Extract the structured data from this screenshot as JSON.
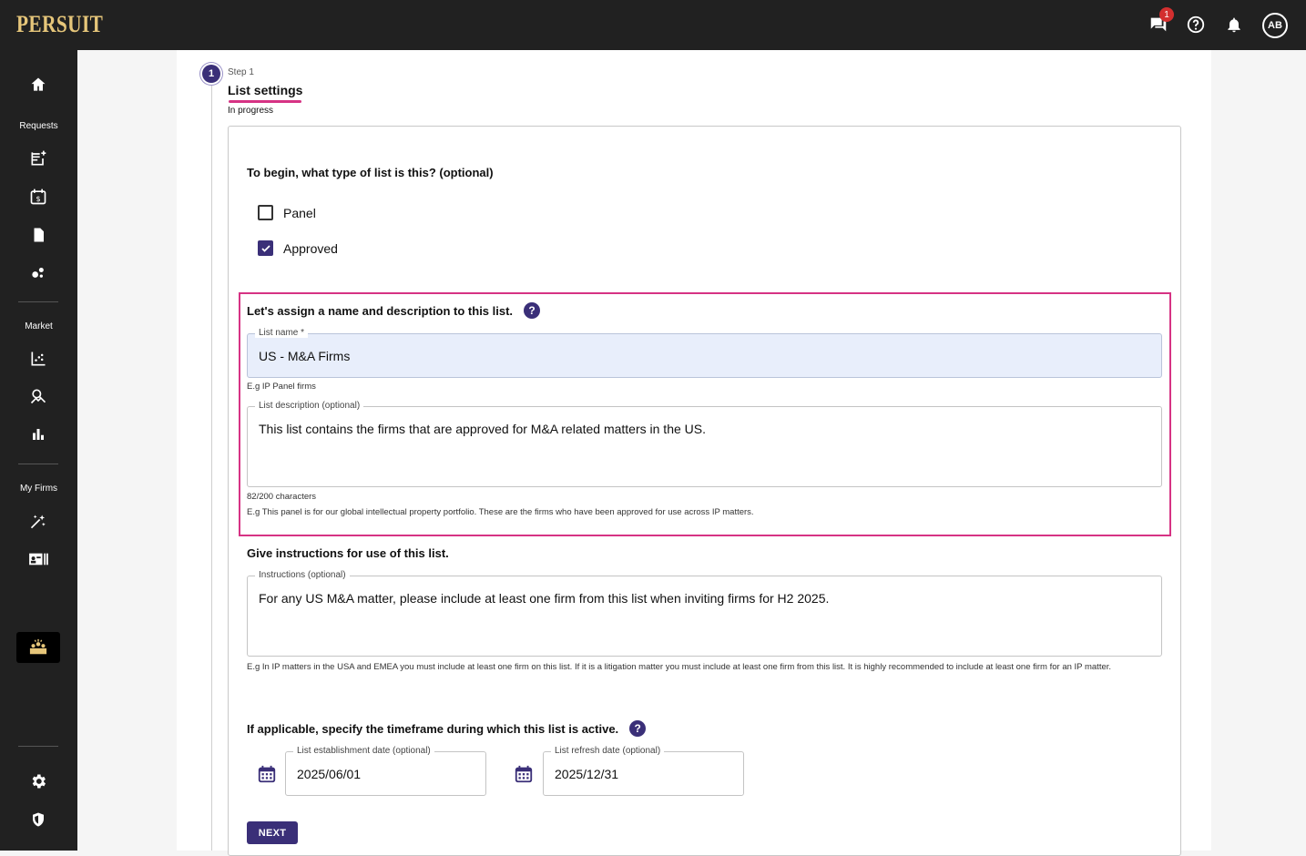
{
  "app": {
    "logo": "PERSUIT"
  },
  "topbar": {
    "icons": [
      "chat-icon",
      "help-icon",
      "bell-icon"
    ],
    "chat_badge": "1",
    "avatar": "AB"
  },
  "sidebar": {
    "sections": {
      "requests": "Requests",
      "market": "Market",
      "my_firms": "My Firms"
    },
    "icons": [
      "home-icon",
      "new-request-icon",
      "calendar-dollar-icon",
      "document-icon",
      "bubbles-icon",
      "scatter-chart-icon",
      "analytics-icon",
      "bar-chart-icon",
      "sparkle-icon",
      "firm-card-icon",
      "panel-list-icon",
      "settings-icon",
      "shield-icon"
    ]
  },
  "step": {
    "number": "1",
    "label": "Step 1",
    "title": "List settings",
    "status": "In progress"
  },
  "list_type": {
    "question": "To begin, what type of list is this? (optional)",
    "options": [
      {
        "label": "Panel",
        "checked": false
      },
      {
        "label": "Approved",
        "checked": true
      }
    ]
  },
  "name_section": {
    "heading": "Let's assign a name and description to this list.",
    "help": "?",
    "list_name": {
      "label": "List name *",
      "value": "US - M&A Firms",
      "hint": "E.g IP Panel firms"
    },
    "description": {
      "label": "List description (optional)",
      "value": "This list contains the firms that are approved for M&A related matters in the US.",
      "count": "82/200 characters",
      "hint": "E.g This panel is for our global intellectual property portfolio. These are the firms who have been approved for use across IP matters."
    }
  },
  "instructions": {
    "heading": "Give instructions for use of this list.",
    "label": "Instructions (optional)",
    "value": "For any US M&A matter, please include at least one firm from this list when inviting firms for H2 2025.",
    "hint": "E.g In IP matters in the USA and EMEA you must include at least one firm on this list. If it is a litigation matter you must include at least one firm from this list. It is highly recommended to include at least one firm for an IP matter."
  },
  "timeframe": {
    "heading": "If applicable, specify the timeframe during which this list is active.",
    "help": "?",
    "establishment": {
      "label": "List establishment date (optional)",
      "value": "2025/06/01"
    },
    "refresh": {
      "label": "List refresh date (optional)",
      "value": "2025/12/31"
    }
  },
  "actions": {
    "next": "NEXT"
  },
  "colors": {
    "accent": "#3a2f78",
    "highlight": "#d63384",
    "logo": "#e6c67a",
    "topbar": "#212121"
  }
}
